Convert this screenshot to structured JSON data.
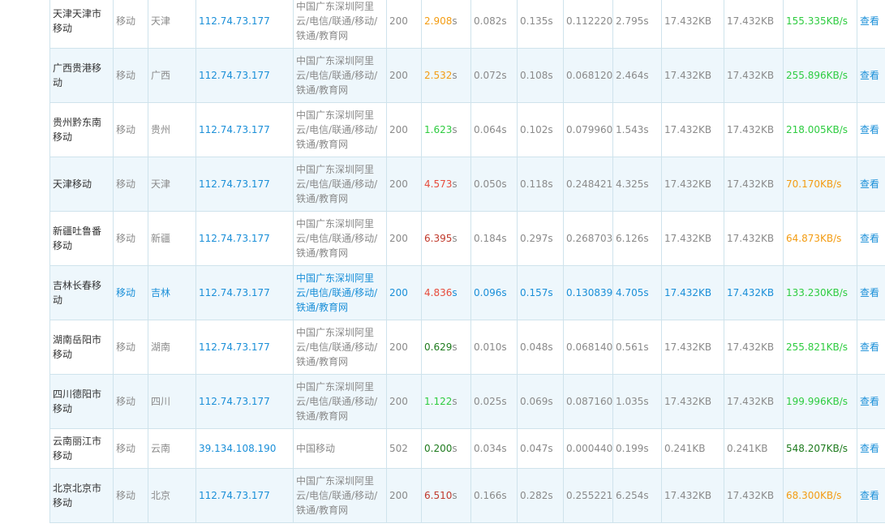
{
  "colors": {
    "link_blue": "#1a8fd8",
    "muted_gray": "#8a8a8a",
    "row_alt_bg": "#eef7fc",
    "border": "#cfe3ec",
    "time_green": "#2ecc40",
    "time_orange": "#f39c12",
    "time_red": "#e74c3c",
    "time_darkred": "#c0392b",
    "time_darkgreen": "#1e7b1e",
    "speed_green": "#2ecc40",
    "speed_orange": "#f39c12",
    "speed_darkgreen": "#1e7b1e"
  },
  "rows": [
    {
      "node": "天津天津市移动",
      "carrier": "移动",
      "region": "天津",
      "ip": "112.74.73.177",
      "isp": "中国广东深圳阿里云/电信/联通/移动/铁通/教育网",
      "status": "200",
      "total_time": "2.908",
      "total_time_color": "#f39c12",
      "dns": "0.082s",
      "connect": "0.135s",
      "ssl": "0.112220s",
      "download": "2.795s",
      "size1": "17.432KB",
      "size2": "17.432KB",
      "speed": "155.335KB/s",
      "speed_color": "#2ecc40",
      "action": "查看",
      "style": "normal"
    },
    {
      "node": "广西贵港移动",
      "carrier": "移动",
      "region": "广西",
      "ip": "112.74.73.177",
      "isp": "中国广东深圳阿里云/电信/联通/移动/铁通/教育网",
      "status": "200",
      "total_time": "2.532",
      "total_time_color": "#f39c12",
      "dns": "0.072s",
      "connect": "0.108s",
      "ssl": "0.068120s",
      "download": "2.464s",
      "size1": "17.432KB",
      "size2": "17.432KB",
      "speed": "255.896KB/s",
      "speed_color": "#2ecc40",
      "action": "查看",
      "style": "alt"
    },
    {
      "node": "贵州黔东南移动",
      "carrier": "移动",
      "region": "贵州",
      "ip": "112.74.73.177",
      "isp": "中国广东深圳阿里云/电信/联通/移动/铁通/教育网",
      "status": "200",
      "total_time": "1.623",
      "total_time_color": "#2ecc40",
      "dns": "0.064s",
      "connect": "0.102s",
      "ssl": "0.079960s",
      "download": "1.543s",
      "size1": "17.432KB",
      "size2": "17.432KB",
      "speed": "218.005KB/s",
      "speed_color": "#2ecc40",
      "action": "查看",
      "style": "normal"
    },
    {
      "node": "天津移动",
      "carrier": "移动",
      "region": "天津",
      "ip": "112.74.73.177",
      "isp": "中国广东深圳阿里云/电信/联通/移动/铁通/教育网",
      "status": "200",
      "total_time": "4.573",
      "total_time_color": "#e74c3c",
      "dns": "0.050s",
      "connect": "0.118s",
      "ssl": "0.248421s",
      "download": "4.325s",
      "size1": "17.432KB",
      "size2": "17.432KB",
      "speed": "70.170KB/s",
      "speed_color": "#f39c12",
      "action": "查看",
      "style": "alt"
    },
    {
      "node": "新疆吐鲁番移动",
      "carrier": "移动",
      "region": "新疆",
      "ip": "112.74.73.177",
      "isp": "中国广东深圳阿里云/电信/联通/移动/铁通/教育网",
      "status": "200",
      "total_time": "6.395",
      "total_time_color": "#c0392b",
      "dns": "0.184s",
      "connect": "0.297s",
      "ssl": "0.268703s",
      "download": "6.126s",
      "size1": "17.432KB",
      "size2": "17.432KB",
      "speed": "64.873KB/s",
      "speed_color": "#f39c12",
      "action": "查看",
      "style": "normal"
    },
    {
      "node": "吉林长春移动",
      "carrier": "移动",
      "region": "吉林",
      "ip": "112.74.73.177",
      "isp": "中国广东深圳阿里云/电信/联通/移动/铁通/教育网",
      "status": "200",
      "total_time": "4.836",
      "total_time_color": "#e74c3c",
      "dns": "0.096s",
      "connect": "0.157s",
      "ssl": "0.130839s",
      "download": "4.705s",
      "size1": "17.432KB",
      "size2": "17.432KB",
      "speed": "133.230KB/s",
      "speed_color": "#2ecc40",
      "action": "查看",
      "style": "highlight"
    },
    {
      "node": "湖南岳阳市移动",
      "carrier": "移动",
      "region": "湖南",
      "ip": "112.74.73.177",
      "isp": "中国广东深圳阿里云/电信/联通/移动/铁通/教育网",
      "status": "200",
      "total_time": "0.629",
      "total_time_color": "#1e7b1e",
      "dns": "0.010s",
      "connect": "0.048s",
      "ssl": "0.068140s",
      "download": "0.561s",
      "size1": "17.432KB",
      "size2": "17.432KB",
      "speed": "255.821KB/s",
      "speed_color": "#2ecc40",
      "action": "查看",
      "style": "normal"
    },
    {
      "node": "四川德阳市移动",
      "carrier": "移动",
      "region": "四川",
      "ip": "112.74.73.177",
      "isp": "中国广东深圳阿里云/电信/联通/移动/铁通/教育网",
      "status": "200",
      "total_time": "1.122",
      "total_time_color": "#2ecc40",
      "dns": "0.025s",
      "connect": "0.069s",
      "ssl": "0.087160s",
      "download": "1.035s",
      "size1": "17.432KB",
      "size2": "17.432KB",
      "speed": "199.996KB/s",
      "speed_color": "#2ecc40",
      "action": "查看",
      "style": "alt"
    },
    {
      "node": "云南丽江市移动",
      "carrier": "移动",
      "region": "云南",
      "ip": "39.134.108.190",
      "isp": "中国移动",
      "status": "502",
      "total_time": "0.200",
      "total_time_color": "#1e7b1e",
      "dns": "0.034s",
      "connect": "0.047s",
      "ssl": "0.000440s",
      "download": "0.199s",
      "size1": "0.241KB",
      "size2": "0.241KB",
      "speed": "548.207KB/s",
      "speed_color": "#1e7b1e",
      "action": "查看",
      "style": "short"
    },
    {
      "node": "北京北京市移动",
      "carrier": "移动",
      "region": "北京",
      "ip": "112.74.73.177",
      "isp": "中国广东深圳阿里云/电信/联通/移动/铁通/教育网",
      "status": "200",
      "total_time": "6.510",
      "total_time_color": "#c0392b",
      "dns": "0.166s",
      "connect": "0.282s",
      "ssl": "0.255221s",
      "download": "6.254s",
      "size1": "17.432KB",
      "size2": "17.432KB",
      "speed": "68.300KB/s",
      "speed_color": "#f39c12",
      "action": "查看",
      "style": "alt"
    }
  ],
  "time_unit": "s"
}
